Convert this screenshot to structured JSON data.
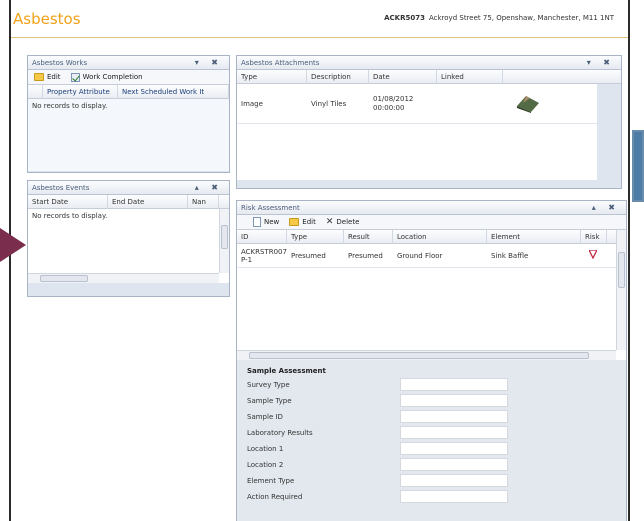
{
  "app": {
    "title": "Asbestos",
    "property_ref": "ACKR5073",
    "property_address": "Ackroyd Street 75, Openshaw, Manchester, M11 1NT"
  },
  "works": {
    "title": "Asbestos Works",
    "controls": "▾ ✖",
    "edit": "Edit",
    "work_completion": "Work Completion",
    "columns": [
      "Property Attribute",
      "Next Scheduled Work It"
    ],
    "empty": "No records to display."
  },
  "events": {
    "title": "Asbestos Events",
    "controls": "▴ ✖",
    "columns": [
      "Start Date",
      "End Date",
      "Nan"
    ],
    "empty": "No records to display."
  },
  "attachments": {
    "title": "Asbestos Attachments",
    "controls": "▾ ✖",
    "columns": [
      "Type",
      "Description",
      "Date",
      "Linked"
    ],
    "rows": [
      {
        "type": "Image",
        "description": "Vinyl Tiles",
        "date": "01/08/2012 00:00:00",
        "linked": ""
      }
    ]
  },
  "risk": {
    "title": "Risk Assessment",
    "controls": "▴ ✖",
    "new": "New",
    "edit": "Edit",
    "delete": "Delete",
    "columns": [
      "ID",
      "Type",
      "Result",
      "Location",
      "Element",
      "Risk"
    ],
    "rows": [
      {
        "id": "ACKRSTR007 P-1",
        "type": "Presumed",
        "result": "Presumed",
        "location": "Ground Floor",
        "element": "Sink Baffle"
      }
    ]
  },
  "sample": {
    "title": "Sample Assessment",
    "fields": [
      "Survey Type",
      "Sample Type",
      "Sample ID",
      "Laboratory Results",
      "Location 1",
      "Location 2",
      "Element Type",
      "Action Required"
    ]
  },
  "colors": {
    "accent": "#f0a21a",
    "panel_header": "#4b5d78"
  }
}
